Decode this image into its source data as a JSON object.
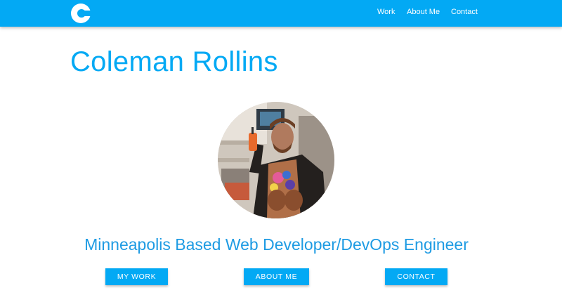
{
  "header": {
    "logo_icon": "c-logo-icon",
    "brand_color": "#03a9f4",
    "nav": [
      {
        "label": "Work"
      },
      {
        "label": "About Me"
      },
      {
        "label": "Contact"
      }
    ]
  },
  "main": {
    "name": "Coleman Rollins",
    "tagline": "Minneapolis Based Web Developer/DevOps Engineer",
    "buttons": [
      {
        "label": "MY WORK"
      },
      {
        "label": "ABOUT ME"
      },
      {
        "label": "CONTACT"
      }
    ]
  }
}
